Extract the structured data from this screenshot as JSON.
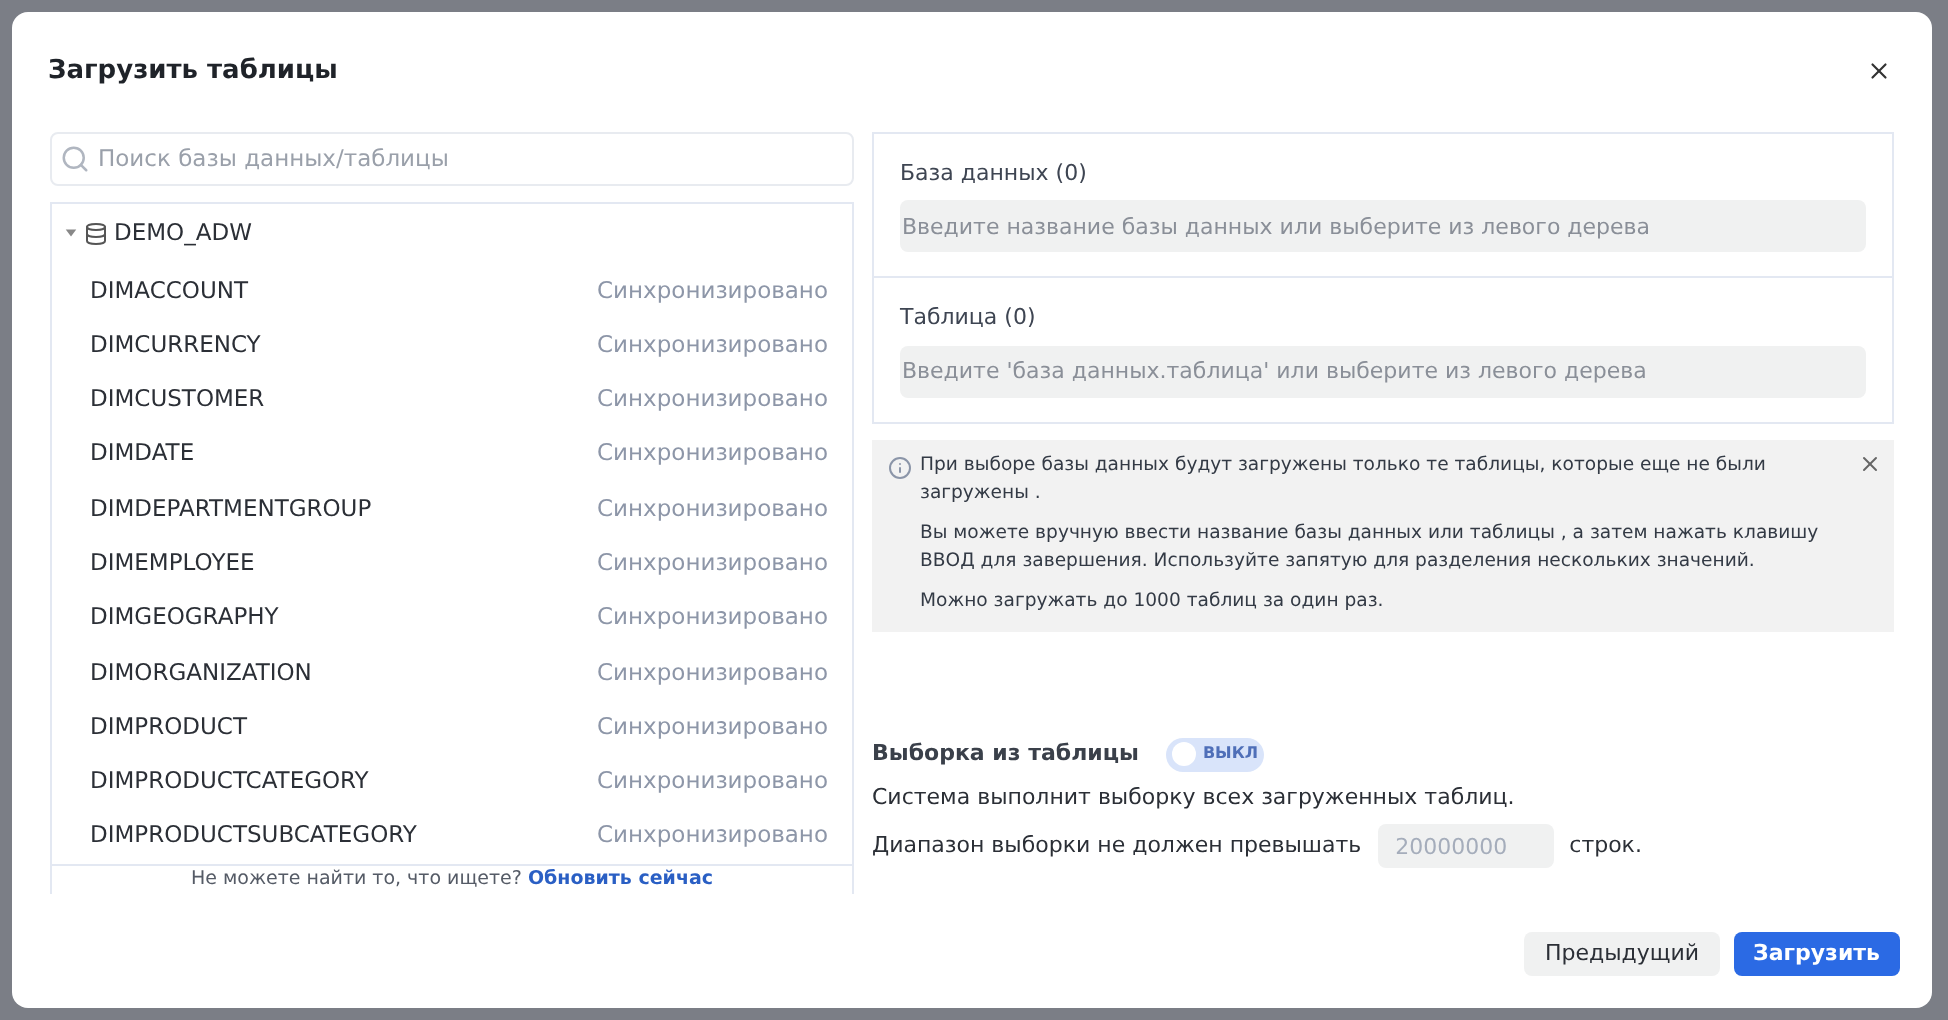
{
  "dialog": {
    "title": "Загрузить таблицы"
  },
  "search": {
    "placeholder": "Поиск базы данных/таблицы"
  },
  "tree": [
    {
      "name": "DEMO_ADW",
      "expanded": true,
      "children": [
        {
          "name": "DIMACCOUNT",
          "status": "Синхронизировано"
        },
        {
          "name": "DIMCURRENCY",
          "status": "Синхронизировано"
        },
        {
          "name": "DIMCUSTOMER",
          "status": "Синхронизировано"
        },
        {
          "name": "DIMDATE",
          "status": "Синхронизировано"
        },
        {
          "name": "DIMDEPARTMENTGROUP",
          "status": "Синхронизировано"
        },
        {
          "name": "DIMEMPLOYEE",
          "status": "Синхронизировано"
        },
        {
          "name": "DIMGEOGRAPHY",
          "status": "Синхронизировано"
        },
        {
          "name": "DIMORGANIZATION",
          "status": "Синхронизировано"
        },
        {
          "name": "DIMPRODUCT",
          "status": "Синхронизировано"
        },
        {
          "name": "DIMPRODUCTCATEGORY",
          "status": "Синхронизировано"
        },
        {
          "name": "DIMPRODUCTSUBCATEGORY",
          "status": "Синхронизировано"
        }
      ]
    }
  ],
  "tree_footer": {
    "text": "Не можете найти то, что ищете?",
    "link": "Обновить сейчас"
  },
  "database_field": {
    "label": "База данных (0)",
    "placeholder": "Введите название базы данных или выберите из левого дерева"
  },
  "table_field": {
    "label": "Таблица (0)",
    "placeholder": "Введите 'база данных.таблица' или выберите из левого дерева"
  },
  "info": {
    "paragraphs": [
      "При выборе базы данных будут загружены только те таблицы, которые еще не были загружены .",
      "Вы можете вручную ввести название базы данных или таблицы , а затем нажать клавишу ВВОД для завершения. Используйте запятую для разделения нескольких значений.",
      "Можно загружать до 1000 таблиц за один раз."
    ]
  },
  "sampling": {
    "label": "Выборка из таблицы",
    "on": false,
    "toggle_label": "ВЫКЛ",
    "description": "Система выполнит выборку всех загруженных таблиц.",
    "range_prefix": "Диапазон выборки не должен превышать",
    "range_placeholder": "20000000",
    "range_suffix": "строк."
  },
  "buttons": [
    {
      "label": "Предыдущий",
      "kind": "secondary"
    },
    {
      "label": "Загрузить",
      "kind": "primary"
    }
  ]
}
